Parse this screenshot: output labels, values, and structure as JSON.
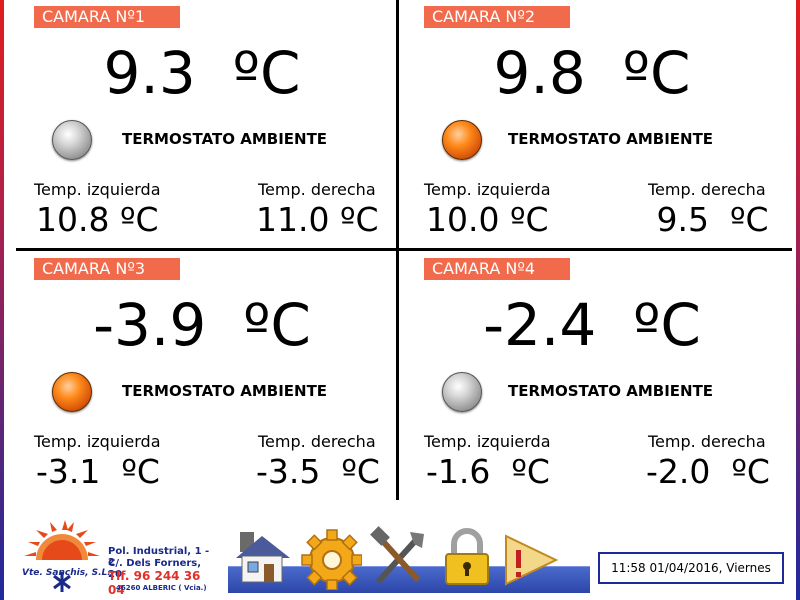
{
  "cameras": [
    {
      "title": "CAMARA Nº1",
      "temp": "9.3  ºC",
      "thermostat_on": false,
      "thermostat_label": "TERMOSTATO AMBIENTE",
      "left_label": "Temp. izquierda",
      "left_value": "10.8 ºC",
      "right_label": "Temp. derecha",
      "right_value": "11.0 ºC"
    },
    {
      "title": "CAMARA Nº2",
      "temp": "9.8  ºC",
      "thermostat_on": true,
      "thermostat_label": "TERMOSTATO AMBIENTE",
      "left_label": "Temp. izquierda",
      "left_value": "10.0 ºC",
      "right_label": "Temp. derecha",
      "right_value": " 9.5  ºC"
    },
    {
      "title": "CAMARA Nº3",
      "temp": "-3.9  ºC",
      "thermostat_on": true,
      "thermostat_label": "TERMOSTATO AMBIENTE",
      "left_label": "Temp. izquierda",
      "left_value": "-3.1  ºC",
      "right_label": "Temp. derecha",
      "right_value": "-3.5  ºC"
    },
    {
      "title": "CAMARA Nº4",
      "temp": "-2.4  ºC",
      "thermostat_on": false,
      "thermostat_label": "TERMOSTATO AMBIENTE",
      "left_label": "Temp. izquierda",
      "left_value": "-1.6  ºC",
      "right_label": "Temp. derecha",
      "right_value": "-2.0  ºC"
    }
  ],
  "company": {
    "name": "Vte. Sanchis, S.L.",
    "addr1": "Pol. Industrial, 1 - 2",
    "addr2": "C/. Dels Forners, 20",
    "tlf": "Tlf. 96 244 36 04",
    "city": "46260 ALBERIC ( Vcia.)"
  },
  "toolbar": {
    "icons": [
      "home-icon",
      "settings-gear-icon",
      "tools-icon",
      "lock-icon",
      "alarm-warning-icon"
    ]
  },
  "datetime": "11:58  01/04/2016, Viernes",
  "colors": {
    "title_bg": "#f26a4c",
    "led_on": "#ff8a1a",
    "led_off": "#b0b0b0",
    "brand_blue": "#1a2a8a"
  }
}
